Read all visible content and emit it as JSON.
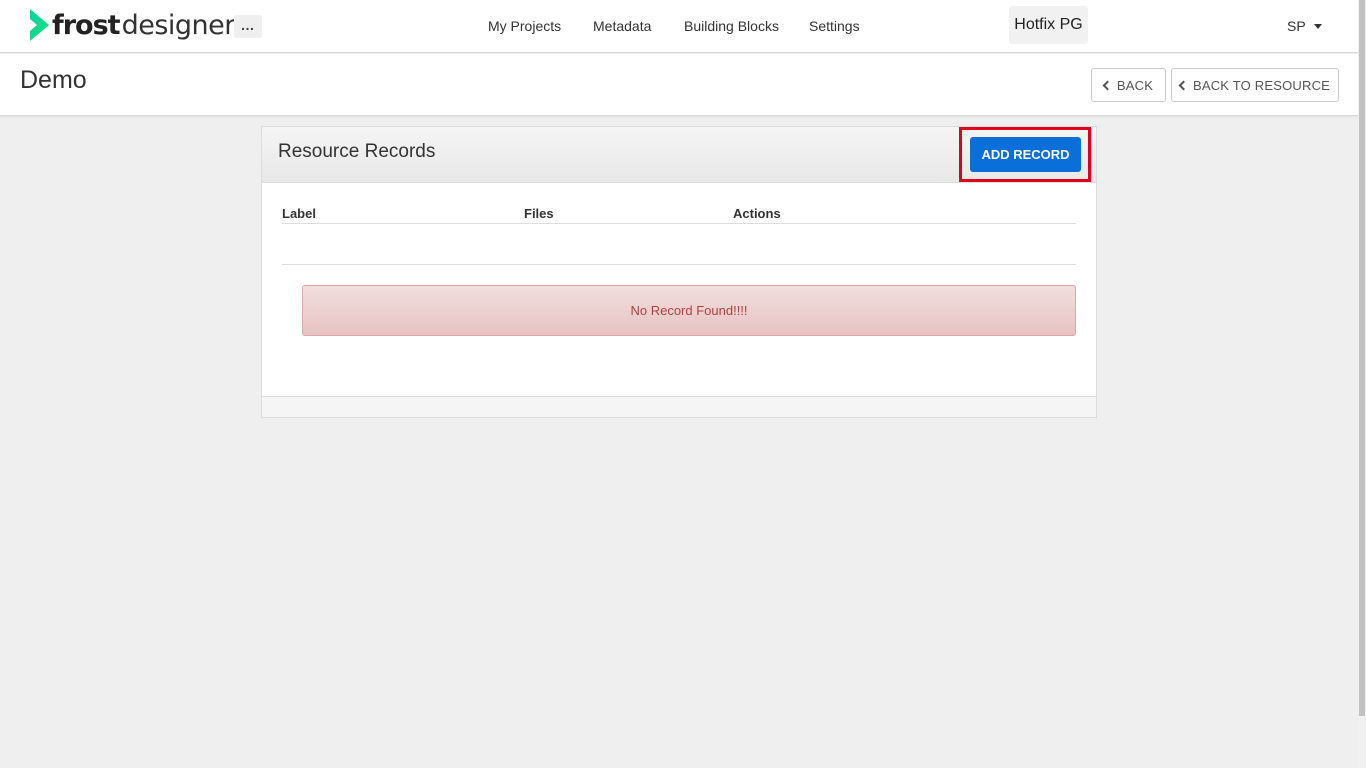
{
  "brand": {
    "name_bold": "frost",
    "name_light": "designer",
    "logo_icon": "chevron-logo-icon",
    "accent": "#14d38b"
  },
  "navbar": {
    "more_label": "…",
    "links": [
      "My Projects",
      "Metadata",
      "Building Blocks",
      "Settings"
    ],
    "project_label": "Hotfix PG",
    "user_label": "SP"
  },
  "page": {
    "title": "Demo",
    "back_label": "BACK",
    "back_to_resource_label": "BACK TO RESOURCE"
  },
  "panel": {
    "title": "Resource Records",
    "add_button_label": "ADD RECORD",
    "columns": [
      "Label",
      "Files",
      "Actions"
    ],
    "empty_message": "No Record Found!!!!"
  },
  "colors": {
    "primary_button": "#0a6fd8",
    "highlight_border": "#e0001a",
    "alert_text": "#a94442",
    "alert_bg": "#f2dede"
  }
}
